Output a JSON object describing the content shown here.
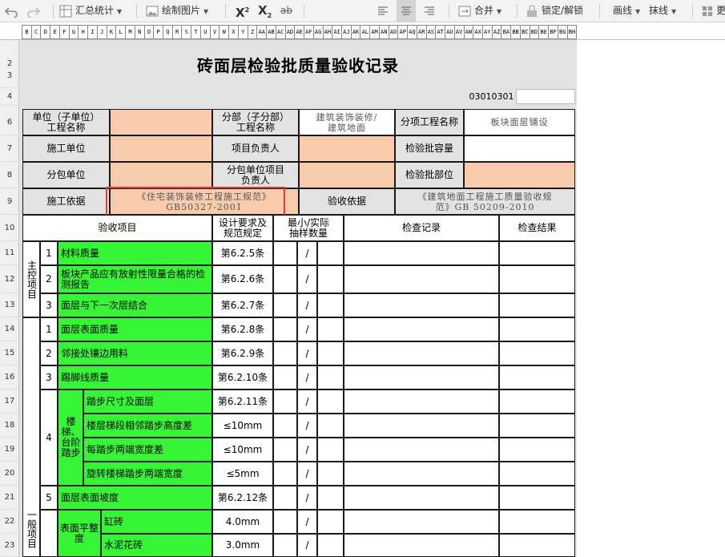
{
  "toolbar": {
    "sum_label": "汇总统计",
    "draw_image_label": "绘制图片",
    "superscript": "X",
    "superscript_mark": "2",
    "subscript": "X",
    "subscript_mark": "2",
    "strike": "ab",
    "merge_label": "合并",
    "lock_label": "锁定/解锁",
    "draw_line_label": "画线",
    "erase_line_label": "抹线",
    "more_label": "更"
  },
  "columns": [
    "B",
    "C",
    "D",
    "E",
    "F",
    "G",
    "H",
    "I",
    "J",
    "K",
    "L",
    "M",
    "N",
    "O",
    "P",
    "Q",
    "R",
    "S",
    "T",
    "U",
    "V",
    "W",
    "X",
    "Y",
    "Z",
    "AA",
    "AB",
    "AC",
    "AD",
    "AE",
    "AF",
    "AG",
    "AH",
    "AI",
    "AJ",
    "AK",
    "AL",
    "AM",
    "AN",
    "AO",
    "AP",
    "AQ",
    "AR",
    "AS",
    "AT",
    "AU",
    "AV",
    "AW",
    "AX",
    "AY",
    "AZ",
    "BA",
    "BB",
    "BC",
    "BD",
    "BE",
    "BF",
    "BG",
    "BH"
  ],
  "rows": [
    "2",
    "3",
    "4",
    "6",
    "7",
    "8",
    "9",
    "10",
    "11",
    "12",
    "13",
    "14",
    "15",
    "16",
    "17",
    "18",
    "19",
    "20",
    "21",
    "22",
    "23"
  ],
  "form": {
    "title": "砖面层检验批质量验收记录",
    "code": "03010301",
    "unit_name_label": "单位（子单位）\n工程名称",
    "sub_division_label": "分部（子分部）\n工程名称",
    "sub_division_value": "建筑装饰装修/\n建筑地面",
    "sub_item_label": "分项工程名称",
    "sub_item_value": "板块面层铺设",
    "constructor_label": "施工单位",
    "pm_label": "项目负责人",
    "capacity_label": "检验批容量",
    "subcontractor_label": "分包单位",
    "sub_pm_label": "分包单位项目\n负责人",
    "part_label": "检验批部位",
    "basis_label": "施工依据",
    "basis_value": "《住宅装饰装修工程施工规范》\nGB50327-2001",
    "accept_basis_label": "验收依据",
    "accept_basis_value": "《建筑地面工程施工质量验收规\n范》GB 50209-2010",
    "h_item": "验收项目",
    "h_design": "设计要求及\n规范规定",
    "h_sample": "最小/实际\n抽样数量",
    "h_record": "检查记录",
    "h_result": "检查结果",
    "main_group": "主控项目",
    "general_group": "一般项目",
    "main_items": [
      {
        "no": "1",
        "name": "材料质量",
        "spec": "第6.2.5条",
        "slash": "/"
      },
      {
        "no": "2",
        "name": "板块产品应有放射性限量合格的检测报告",
        "spec": "第6.2.6条",
        "slash": "/"
      },
      {
        "no": "3",
        "name": "面层与下一次层结合",
        "spec": "第6.2.7条",
        "slash": "/"
      }
    ],
    "general_items": [
      {
        "no": "1",
        "name": "面层表面质量",
        "spec": "第6.2.8条",
        "slash": "/"
      },
      {
        "no": "2",
        "name": "邻接处镶边用料",
        "spec": "第6.2.9条",
        "slash": "/"
      },
      {
        "no": "3",
        "name": "踢脚线质量",
        "spec": "第6.2.10条",
        "slash": "/"
      }
    ],
    "stair_no": "4",
    "stair_label": "楼梯、台阶踏步",
    "stair_items": [
      {
        "name": "踏步尺寸及面层",
        "spec": "第6.2.11条",
        "slash": "/"
      },
      {
        "name": "楼层梯段相邻踏步高度差",
        "spec": "≤10mm",
        "slash": "/"
      },
      {
        "name": "每踏步两端宽度差",
        "spec": "≤10mm",
        "slash": "/"
      },
      {
        "name": "旋转楼梯踏步两端宽度",
        "spec": "≤5mm",
        "slash": "/"
      }
    ],
    "slope_no": "5",
    "slope_name": "面层表面坡度",
    "slope_spec": "第6.2.12条",
    "slope_slash": "/",
    "flat_label": "表面平整度",
    "flat_items": [
      {
        "name": "缸砖",
        "spec": "4.0mm",
        "slash": "/"
      },
      {
        "name": "水泥花砖",
        "spec": "3.0mm",
        "slash": "/"
      }
    ]
  }
}
